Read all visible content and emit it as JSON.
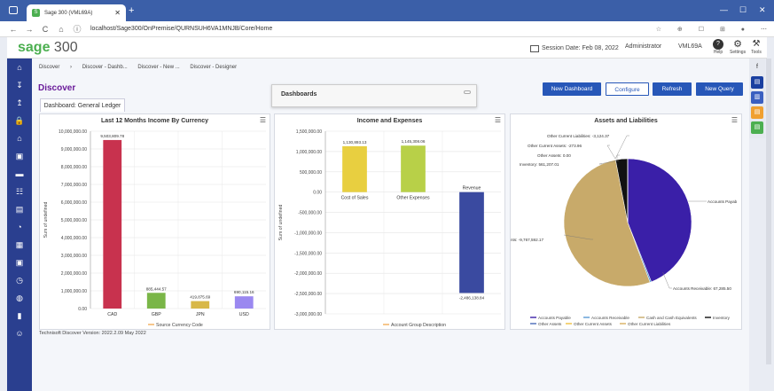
{
  "browser": {
    "tab_title": "Sage 300 (VML69A)",
    "tab_icon_glyph": "S",
    "url": "localhost/Sage300/OnPremise/QURNSUH6VA1MNJB/Core/Home",
    "nav_glyphs": {
      "back": "←",
      "forward": "→",
      "refresh": "C",
      "home": "⌂",
      "info": "ⓘ"
    },
    "window_glyphs": {
      "minimize": "—",
      "maximize": "☐",
      "close": "✕",
      "new_tab": "+",
      "menu": "⋯"
    }
  },
  "app": {
    "logo_sage": "sage",
    "logo_num": "300",
    "session_label": "Session Date: Feb 08, 2022",
    "user": "Administrator",
    "company": "VML69A",
    "help_label": "Help",
    "settings_label": "Settings",
    "tools_label": "Tools",
    "help_glyph": "?",
    "settings_glyph": "⚙",
    "tools_glyph": "⚒"
  },
  "breadcrumb": [
    "Discover",
    "Discover - Dashb...",
    "Discover - New ...",
    "Discover - Designer"
  ],
  "page": {
    "title": "Discover",
    "tab_label": "Dashboard: General Ledger",
    "dashboards_panel_title": "Dashboards",
    "buttons": {
      "new_dashboard": "New Dashboard",
      "configure": "Configure",
      "refresh": "Refresh",
      "new_query": "New Query"
    },
    "footer": "Technisoft Discover Version: 2022.2.09 May 2022"
  },
  "left_nav_icons": [
    "home-icon",
    "import-icon",
    "export-icon",
    "lock-icon",
    "bank-icon",
    "briefcase-icon",
    "folder-icon",
    "users-icon",
    "document-icon",
    "pie-icon",
    "report-icon",
    "calendar-icon",
    "clock-icon",
    "globe-icon",
    "chart-icon",
    "smiley-icon"
  ],
  "left_nav_glyphs": [
    "⌂",
    "↧",
    "↥",
    "🔒",
    "⌂",
    "▣",
    "▬",
    "☷",
    "▤",
    "◔",
    "▦",
    "▣",
    "◷",
    "◍",
    "▮",
    "☺"
  ],
  "right_bar_colors": [
    "#1a3fa0",
    "#3a5fc0",
    "#f0a030",
    "#4caf50"
  ],
  "right_bar_glyphs": [
    "f",
    "▤",
    "▥",
    "▤",
    "▤"
  ],
  "colors": {
    "accent": "#2757b8",
    "nav": "#2a3f8f",
    "title": "#6a1b9a"
  },
  "chart_data": [
    {
      "type": "bar",
      "title": "Last 12 Months Income By Currency",
      "ylabel": "Sum of undefined",
      "legend": [
        "Source Currency Code"
      ],
      "categories": [
        "CAD",
        "GBP",
        "JPN",
        "USD"
      ],
      "values": [
        9503809.78,
        885444.57,
        419875.69,
        690115.16
      ],
      "labels": [
        "9,503,809.78",
        "885,444.57",
        "419,875.69",
        "690,115.16"
      ],
      "colors": [
        "#c8324e",
        "#7ab648",
        "#d8b848",
        "#9a88f0"
      ],
      "ylim": [
        0,
        10000000
      ],
      "yticks": [
        0,
        1000000,
        2000000,
        3000000,
        4000000,
        5000000,
        6000000,
        7000000,
        8000000,
        9000000,
        10000000
      ],
      "ytick_labels": [
        "0.00",
        "1,000,000.00",
        "2,000,000.00",
        "3,000,000.00",
        "4,000,000.00",
        "5,000,000.00",
        "6,000,000.00",
        "7,000,000.00",
        "8,000,000.00",
        "9,000,000.00",
        "10,000,000.00"
      ]
    },
    {
      "type": "bar",
      "title": "Income and Expenses",
      "ylabel": "Sum of undefined",
      "legend": [
        "Account Group Description"
      ],
      "categories": [
        "Cost of Sales",
        "Other Expenses",
        "Revenue"
      ],
      "values": [
        1130893.13,
        1145308.06,
        -2486138.84
      ],
      "labels": [
        "1,130,893.13",
        "1,145,308.06",
        "-2,486,138.84"
      ],
      "colors": [
        "#e8cf40",
        "#b8d048",
        "#3a4aa0"
      ],
      "ylim": [
        -3000000,
        1500000
      ],
      "yticks": [
        -3000000,
        -2500000,
        -2000000,
        -1500000,
        -1000000,
        -500000,
        0,
        500000,
        1000000,
        1500000
      ],
      "ytick_labels": [
        "-3,000,000.00",
        "-2,500,000.00",
        "-2,000,000.00",
        "-1,500,000.00",
        "-1,000,000.00",
        "-500,000.00",
        "0.00",
        "500,000.00",
        "1,000,000.00",
        "1,500,000.00"
      ]
    },
    {
      "type": "pie",
      "title": "Assets and Liabilities",
      "slices": [
        {
          "name": "Accounts Payable",
          "value": 8157000,
          "color": "#3a1fa8",
          "label": "Accounts Payab"
        },
        {
          "name": "Accounts Receivable",
          "value": 67285.5,
          "color": "#5b9bd5",
          "label": "Accounts Receivable: 67,285.50"
        },
        {
          "name": "Cash and Cash Equivalents",
          "value": 9767592.17,
          "color": "#c8aa6a",
          "label": "nts: -9,767,592.17"
        },
        {
          "name": "Inventory",
          "value": 561207.01,
          "color": "#111111",
          "label": "Inventory: 561,207.01"
        },
        {
          "name": "Other Assets",
          "value": 0,
          "color": "#4a6ab8",
          "label": "Other Assets: 0.00"
        },
        {
          "name": "Other Current Assets",
          "value": 273.96,
          "color": "#f0c040",
          "label": "Other Current Assets: -273.96"
        },
        {
          "name": "Other Current Liabilities",
          "value": 3124.37,
          "color": "#d8b060",
          "label": "Other Current Liabilities: -3,124.37"
        }
      ],
      "legend": [
        "Accounts Payable",
        "Accounts Receivable",
        "Cash and Cash Equivalents",
        "Inventory",
        "Other Assets",
        "Other Current Assets",
        "Other Current Liabilities"
      ]
    }
  ]
}
